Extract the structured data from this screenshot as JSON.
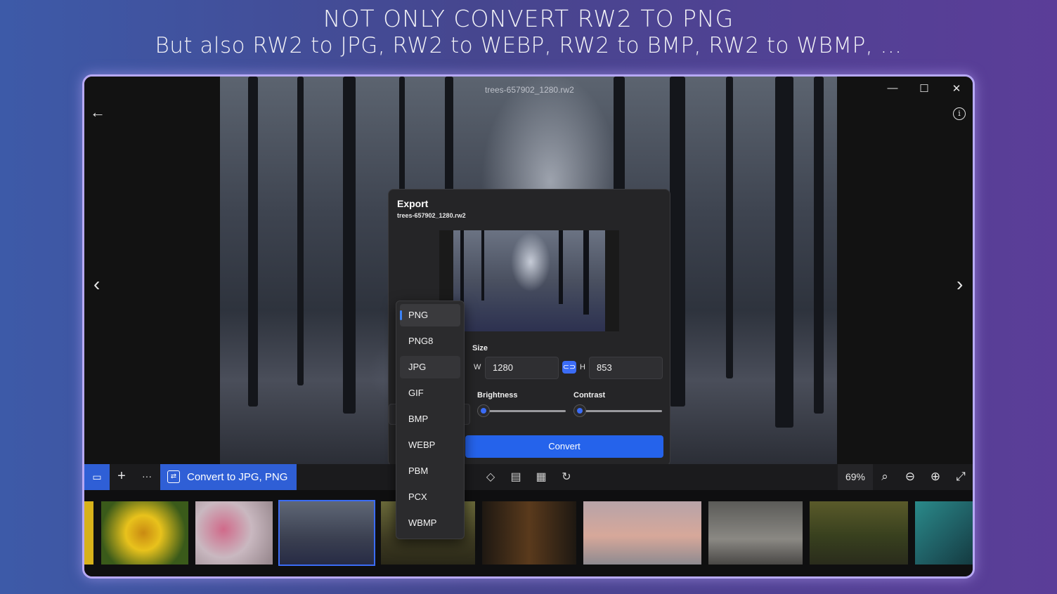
{
  "banner": {
    "line1": "NOT ONLY CONVERT RW2 TO PNG",
    "line2": "But also RW2 to JPG, RW2 to WEBP, RW2 to BMP,  RW2 to WBMP, ..."
  },
  "window": {
    "title_filename": "trees-657902_1280.rw2",
    "minimize": "—",
    "maximize": "☐",
    "close": "✕"
  },
  "icons": {
    "back": "←",
    "info": "i",
    "prev": "‹",
    "next": "›"
  },
  "export": {
    "title": "Export",
    "filename": "trees-657902_1280.rw2",
    "size_label": "Size",
    "w_label": "W",
    "h_label": "H",
    "width_value": "1280",
    "height_value": "853",
    "brightness_label": "Brightness",
    "contrast_label": "Contrast",
    "brightness_level": 0,
    "contrast_level": 0,
    "convert_label": "Convert"
  },
  "formats": {
    "selected": "PNG",
    "items": [
      "PNG",
      "PNG8",
      "JPG",
      "GIF",
      "BMP",
      "WEBP",
      "PBM",
      "PCX",
      "WBMP"
    ]
  },
  "toolbar": {
    "gallery_icon": "▭",
    "add_icon": "+",
    "more_icon": "···",
    "convert_label": "Convert to JPG, PNG",
    "zoom_level": "69%"
  },
  "colors": {
    "accent": "#2f5fd6",
    "convert_button": "#2563eb",
    "frame_glow": "#b7a9f5"
  }
}
